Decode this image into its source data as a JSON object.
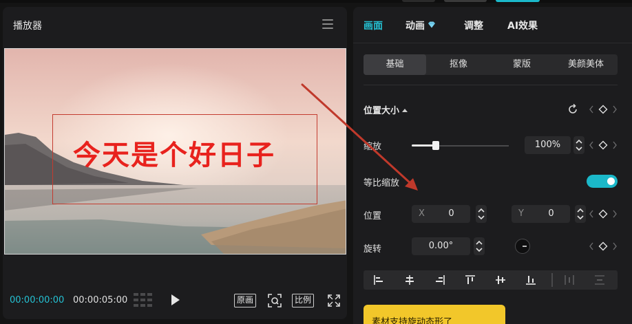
{
  "player": {
    "title": "播放器",
    "caption": "今天是个好日子",
    "time_current": "00:00:00:00",
    "time_total": "00:00:05:00",
    "btn_original": "原画",
    "btn_ratio": "比例"
  },
  "inspector": {
    "tabs": [
      {
        "label": "画面",
        "active": true
      },
      {
        "label": "动画",
        "badge": "diamond-icon"
      },
      {
        "label": "调整"
      },
      {
        "label": "AI效果"
      }
    ],
    "subtabs": [
      {
        "label": "基础",
        "active": true
      },
      {
        "label": "抠像"
      },
      {
        "label": "蒙版"
      },
      {
        "label": "美颜美体"
      }
    ],
    "section_title": "位置大小",
    "scale": {
      "label": "缩放",
      "value": "100%",
      "slider_percent": 100
    },
    "uniform_scale": {
      "label": "等比缩放",
      "on": true
    },
    "position": {
      "label": "位置",
      "x_prefix": "X",
      "x_value": "0",
      "y_prefix": "Y",
      "y_value": "0"
    },
    "rotation": {
      "label": "旋转",
      "value": "0.00°"
    },
    "note": "素材支持旋动态形了"
  },
  "colors": {
    "accent": "#25c2d4",
    "toggle": "#1bb8c9",
    "caption": "#e8221d",
    "note": "#f2c72a",
    "annotation": "#c0392b"
  }
}
